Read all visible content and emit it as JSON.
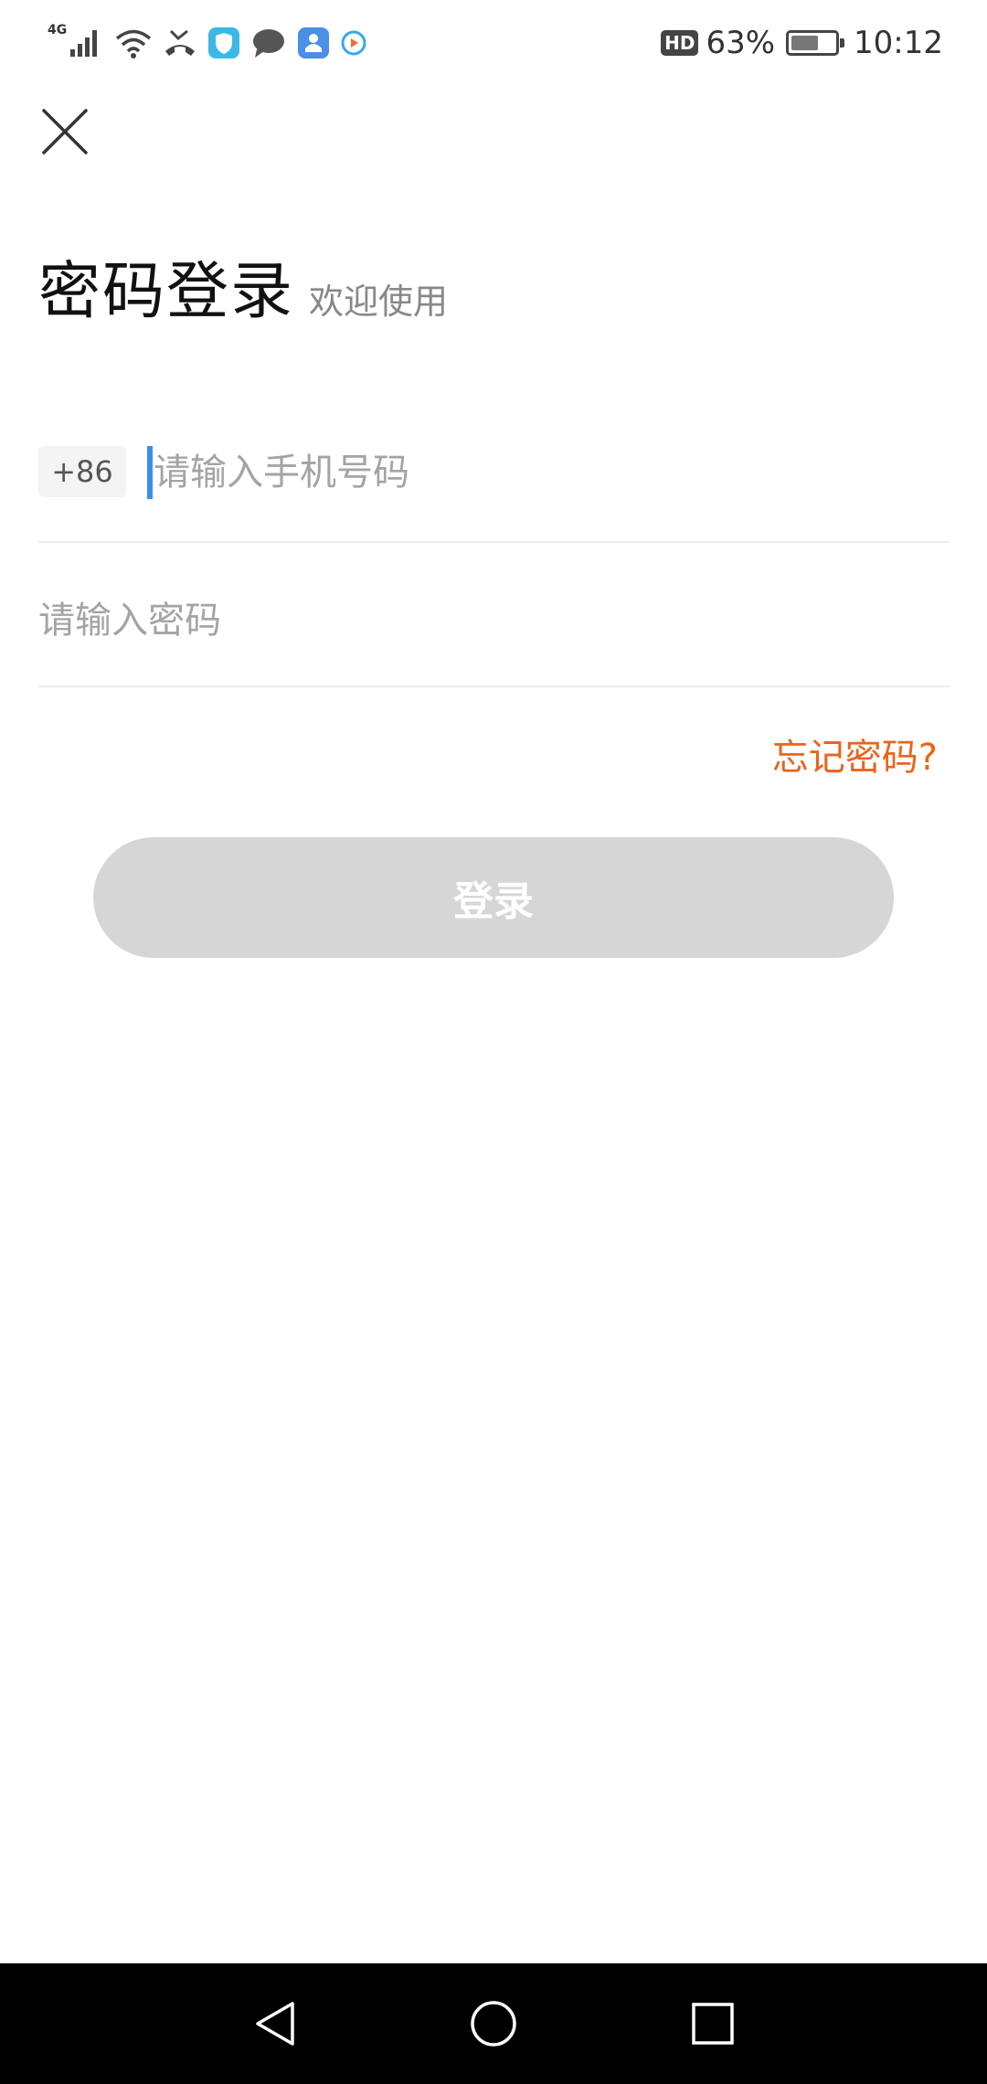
{
  "status_bar": {
    "network": "4G",
    "hd_label": "HD",
    "battery": "63%",
    "battery_level": 0.63,
    "time": "10:12"
  },
  "header": {
    "title": "密码登录",
    "subtitle": "欢迎使用"
  },
  "form": {
    "country_code": "+86",
    "phone_placeholder": "请输入手机号码",
    "phone_value": "",
    "password_placeholder": "请输入密码",
    "password_value": "",
    "forgot_label": "忘记密码?",
    "login_label": "登录"
  },
  "colors": {
    "accent": "#e8651a",
    "caret": "#3a8ee6",
    "button_disabled": "#d6d6d6"
  }
}
